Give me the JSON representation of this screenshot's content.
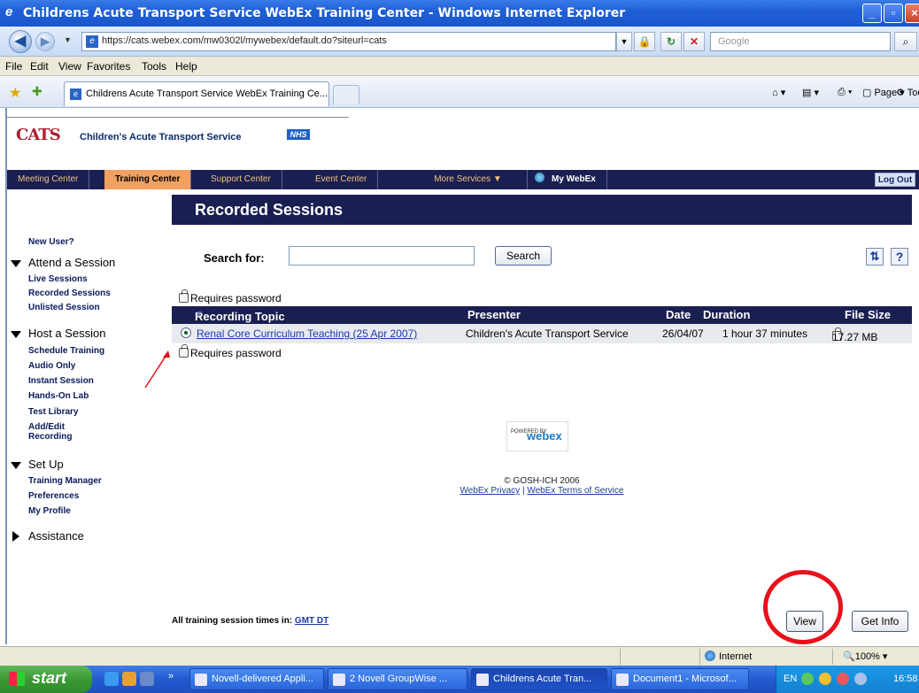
{
  "window": {
    "title": "Childrens Acute Transport Service WebEx Training Center - Windows Internet Explorer"
  },
  "addressbar": {
    "url": "https://cats.webex.com/mw0302l/mywebex/default.do?siteurl=cats",
    "search_placeholder": "Google"
  },
  "menubar": [
    "File",
    "Edit",
    "View",
    "Favorites",
    "Tools",
    "Help"
  ],
  "tab": {
    "title": "Childrens Acute Transport Service WebEx Training Ce..."
  },
  "commandbar": {
    "page_label": "Page",
    "tools_label": "Tools"
  },
  "site": {
    "logo_text": "CATS",
    "org_name": "Children's Acute Transport Service",
    "nhs_badge": "NHS"
  },
  "nav": {
    "items": [
      "Meeting Center",
      "Training Center",
      "Support Center",
      "Event Center",
      "More Services ▼",
      "My WebEx"
    ],
    "active": "Training Center",
    "logout_label": "Log Out"
  },
  "sidebar": {
    "new_user": "New User?",
    "attend_heading": "Attend a Session",
    "attend_items": [
      "Live Sessions",
      "Recorded Sessions",
      "Unlisted Session"
    ],
    "host_heading": "Host a Session",
    "host_items": [
      "Schedule Training",
      "Audio Only",
      "Instant Session",
      "Hands-On Lab",
      "Test Library",
      "Add/Edit",
      "Recording"
    ],
    "setup_heading": "Set Up",
    "setup_items": [
      "Training Manager",
      "Preferences",
      "My Profile"
    ],
    "assistance_heading": "Assistance"
  },
  "main": {
    "header": "Recorded Sessions",
    "search_label": "Search for:",
    "search_value": "",
    "search_button": "Search",
    "requires_password": "Requires password",
    "table": {
      "columns": [
        "Recording Topic",
        "Presenter",
        "Date",
        "Duration",
        "File Size"
      ],
      "rows": [
        {
          "topic": "Renal Core Curriculum Teaching (25 Apr 2007)",
          "presenter": "Children's Acute Transport Service",
          "date": "26/04/07",
          "duration": "1 hour 37 minutes",
          "file_size": "17.27 MB"
        }
      ]
    },
    "powered_by": "POWERED BY",
    "powered_brand": "webex",
    "copyright": "© GOSH-ICH 2006",
    "privacy_link": "WebEx Privacy",
    "footer_separator": "|",
    "terms_link": "WebEx Terms of Service",
    "timezone_label": "All training session times in:",
    "timezone_value": "GMT DT",
    "view_button": "View",
    "getinfo_button": "Get Info"
  },
  "statusbar": {
    "zone": "Internet",
    "zoom": "100%"
  },
  "taskbar": {
    "start_label": "start",
    "tasks": [
      "Novell-delivered Appli...",
      "2 Novell GroupWise ...",
      "Childrens Acute Tran...",
      "Document1 - Microsof..."
    ],
    "active_task": "Childrens Acute Tran...",
    "language": "EN",
    "clock": "16:58"
  },
  "colors": {
    "nav_bg": "#1a1f52",
    "nav_active": "#f2a060",
    "annotation_red": "#e8101a",
    "link_blue": "#1a3aa8"
  }
}
